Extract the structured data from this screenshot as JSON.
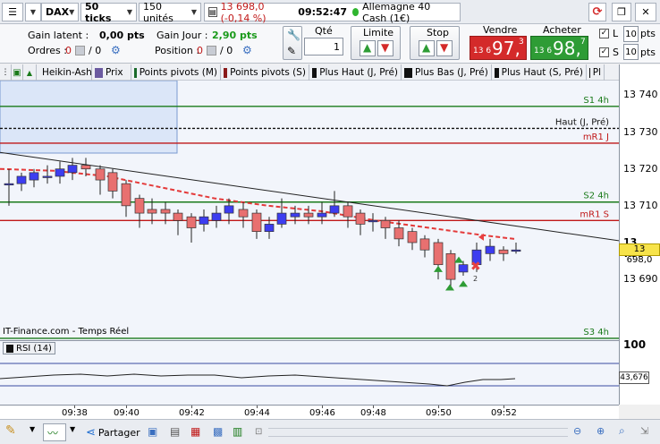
{
  "toolbar": {
    "symbol": "DAX",
    "ticks": "50 ticks",
    "units": "150 unités",
    "change": "13 698,0 (-0,14 %)",
    "time": "09:52:47",
    "instrument": "Allemagne 40 Cash (1€)"
  },
  "order": {
    "gain_latent_label": "Gain latent :",
    "gain_latent_value": "0,00 pts",
    "ordres_label": "Ordres :",
    "ordres_value_a": "0",
    "ordres_value_b": "/ 0",
    "gain_jour_label": "Gain Jour :",
    "gain_jour_value": "2,90 pts",
    "position_label": "Position :",
    "position_value_a": "0",
    "position_value_b": "/ 0",
    "qty_label": "Qté",
    "qty_value": "1",
    "limite_label": "Limite",
    "stop_label": "Stop",
    "vendre_label": "Vendre",
    "vendre_small": "13 6",
    "vendre_big": "97,",
    "vendre_sup": "3",
    "acheter_label": "Acheter",
    "acheter_small": "13 6",
    "acheter_big": "98,",
    "acheter_sup": "7",
    "l_label": "L",
    "l_value": "10",
    "l_unit": "pts",
    "s_label": "S",
    "s_value": "10",
    "s_unit": "pts"
  },
  "indicators": [
    {
      "label": "Heikin-Ashi",
      "color": "#7a1a1a"
    },
    {
      "label": "Prix",
      "color": "#6b5aa0"
    },
    {
      "label": "Points pivots (M)",
      "color": "#1a6a2a"
    },
    {
      "label": "Points pivots (S)",
      "color": "#8a1a1a"
    },
    {
      "label": "Plus Haut (J, Pré)",
      "color": "#111111"
    },
    {
      "label": "Plus Bas (J, Pré)",
      "color": "#111111"
    },
    {
      "label": "Plus Haut (S, Pré)",
      "color": "#111111"
    },
    {
      "label": "Pl",
      "color": "#111111"
    }
  ],
  "chart": {
    "levels": [
      {
        "label": "S1 4h",
        "value": 13737,
        "color": "#1a7a1a"
      },
      {
        "label": "Haut (J, Pré)",
        "value": 13731,
        "color": "#111111"
      },
      {
        "label": "mR1 J",
        "value": 13727,
        "color": "#c01818"
      },
      {
        "label": "S2 4h",
        "value": 13711,
        "color": "#1a7a1a"
      },
      {
        "label": "mR1 S",
        "value": 13706,
        "color": "#c01818"
      },
      {
        "label": "S3 4h",
        "value": 13674,
        "color": "#1a7a1a"
      }
    ],
    "price_ticks": [
      "13 740",
      "13 730",
      "13 720",
      "13 710",
      "13 700",
      "13 690"
    ],
    "current_price": "13 698,0",
    "source": "IT-Finance.com - Temps Réel",
    "marker_count": "2"
  },
  "rsi": {
    "label": "RSI (14)",
    "top_value": "100",
    "current": "43,676"
  },
  "time_ticks": [
    "09:38",
    "09:40",
    "09:42",
    "09:44",
    "09:46",
    "09:48",
    "09:50",
    "09:52"
  ],
  "bottom": {
    "share_label": "Partager"
  },
  "colors": {
    "sell": "#d42a2a",
    "buy": "#2e9c35",
    "bull_candle": "#3d3df0",
    "bear_candle": "#e87070"
  }
}
